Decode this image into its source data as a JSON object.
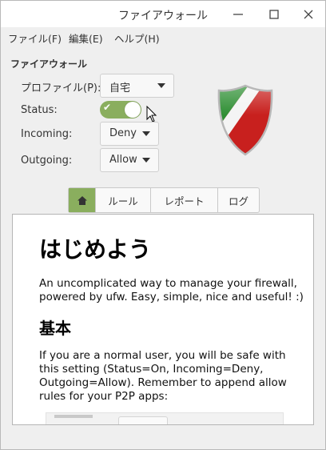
{
  "window": {
    "title": "ファイアウォール",
    "controls": [
      "minimize",
      "maximize",
      "close"
    ]
  },
  "menu": {
    "file": "ファイル(F)",
    "edit": "編集(E)",
    "help": "ヘルプ(H)"
  },
  "firewall": {
    "section_title": "ファイアウォール",
    "profile_label": "プロファイル(P):",
    "profile_value": "自宅",
    "status_label": "Status:",
    "status_on": true,
    "incoming_label": "Incoming:",
    "incoming_value": "Deny",
    "outgoing_label": "Outgoing:",
    "outgoing_value": "Allow"
  },
  "tabs": [
    {
      "label": "",
      "icon": "home-icon",
      "active": true
    },
    {
      "label": "ルール",
      "active": false
    },
    {
      "label": "レポート",
      "active": false
    },
    {
      "label": "ログ",
      "active": false
    }
  ],
  "content": {
    "heading": "はじめよう",
    "intro": "An uncomplicated way to manage your firewall, powered by ufw. Easy, simple, nice and useful! :)",
    "subheading": "基本",
    "basic_text": "If you are a normal user, you will be safe with this setting (Status=On, Incoming=Deny, Outgoing=Allow). Remember to append allow rules for your P2P apps:"
  },
  "colors": {
    "accent_green": "#8aae5e",
    "shield_green": "#3a9a3a",
    "shield_red": "#c8201e"
  }
}
